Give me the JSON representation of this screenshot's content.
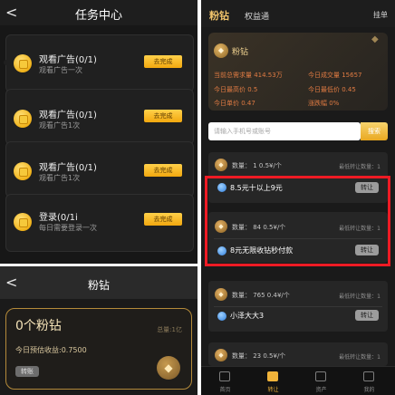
{
  "task_center": {
    "back_glyph": "<",
    "title": "任务中心",
    "button_label": "去完成",
    "tasks": [
      {
        "title": "观看广告(0/1)",
        "subtitle": "观看广告一次"
      },
      {
        "title": "观看广告(0/1)",
        "subtitle": "观看广告1次"
      },
      {
        "title": "观看广告(0/1)",
        "subtitle": "观看广告1次"
      },
      {
        "title": "登录(0/1i",
        "subtitle": "每日需要登录一次"
      }
    ]
  },
  "diamond_detail": {
    "back_glyph": "<",
    "title": "粉钻",
    "amount": "0个粉钻",
    "total": "总量:1亿",
    "estimate": "今日预估收益:0.7500",
    "transfer_label": "转账"
  },
  "market": {
    "brand": "粉钻",
    "tab": "权益通",
    "sell": "挂单",
    "asset_name": "粉钻",
    "stats": [
      "当前总需求量 414.53万",
      "今日成交量 15657",
      "今日最高价 0.5",
      "今日最低价 0.45",
      "今日单价 0.47",
      "涨跌幅 0%"
    ],
    "search_placeholder": "请输入手机号或账号",
    "search_button": "搜索",
    "min_label": "最低转让数量：1",
    "transfer_label": "转让",
    "listings": [
      {
        "qty": "数量： 1  0.5¥/个",
        "user": "8.5元十以上9元"
      },
      {
        "qty": "数量： 84  0.5¥/个",
        "user": "8元无限收钻秒付款"
      },
      {
        "qty": "数量： 765  0.4¥/个",
        "user": "小泽大大3"
      },
      {
        "qty": "数量： 23  0.5¥/个",
        "user": ""
      }
    ],
    "nav": [
      "首页",
      "转让",
      "资产",
      "我的"
    ],
    "active_nav": 1
  },
  "colors": {
    "accent_gold": "#f2a80f",
    "highlight_red": "#ee1b24",
    "stat_orange": "#e07b43"
  }
}
